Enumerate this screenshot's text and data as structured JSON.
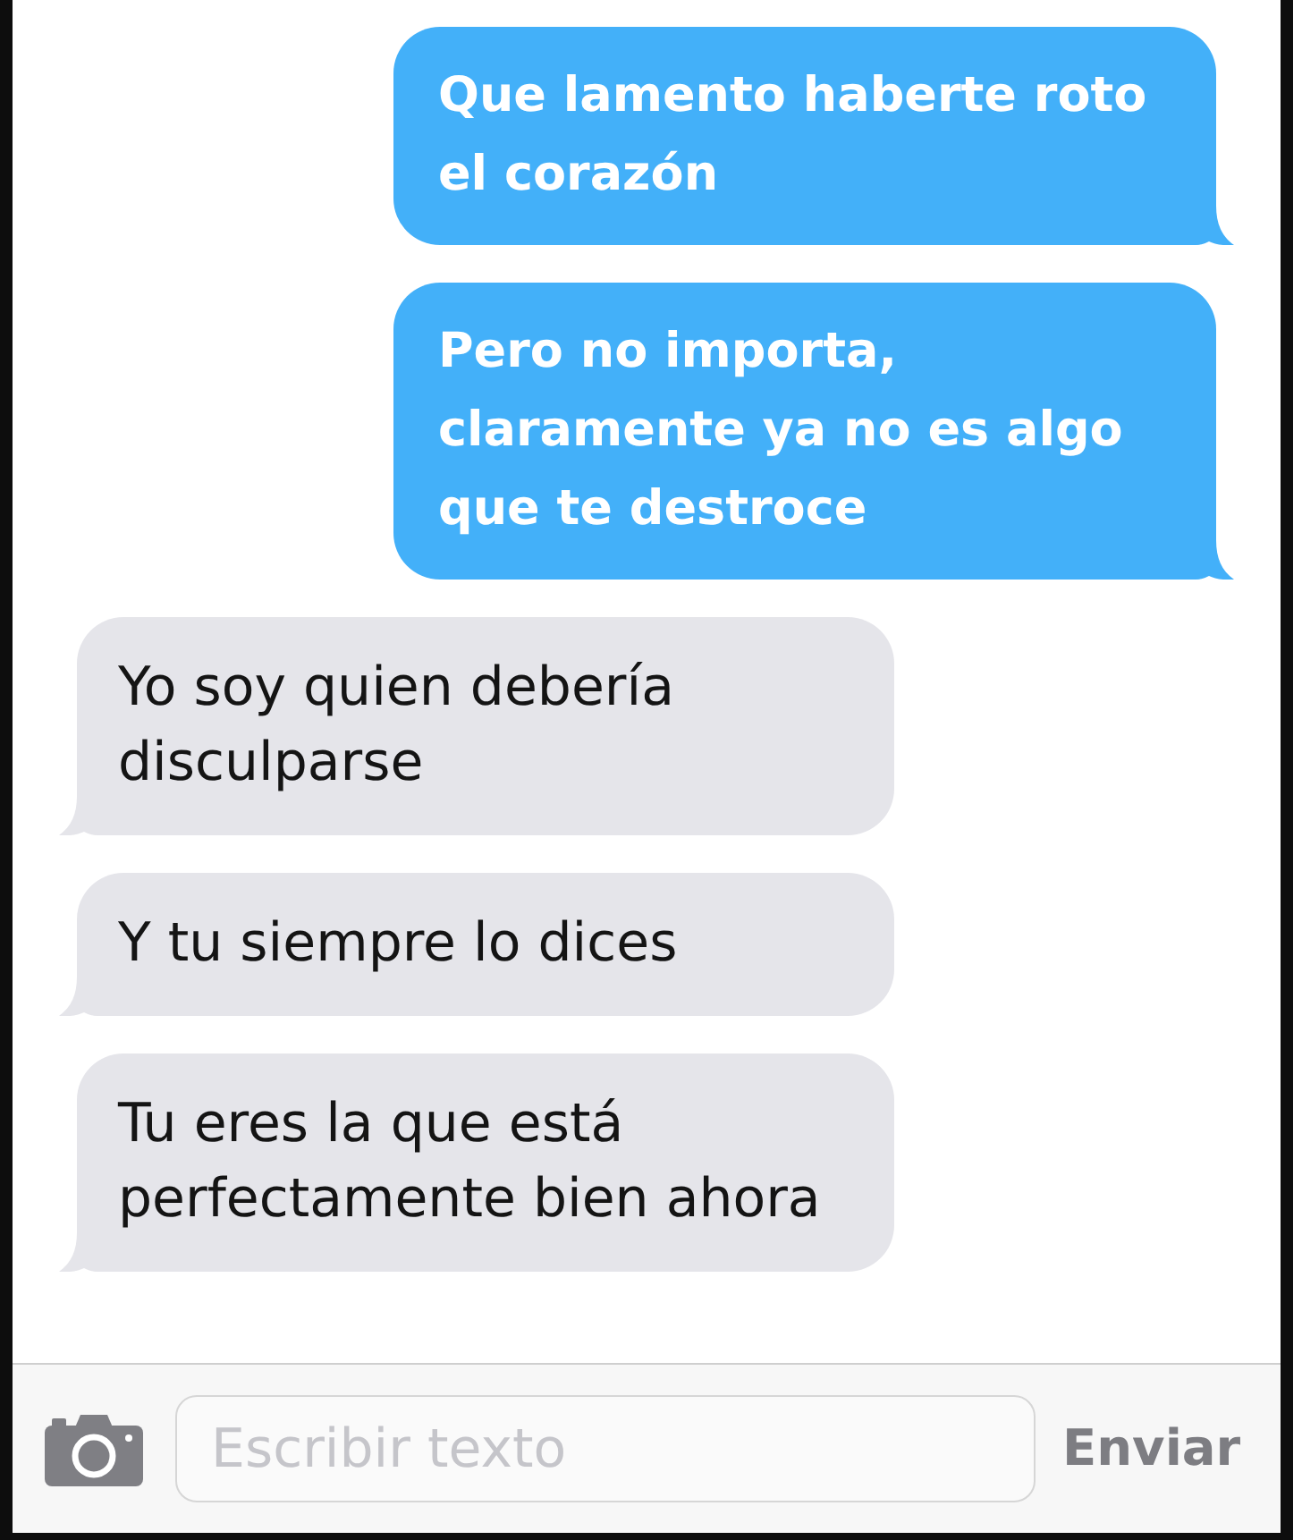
{
  "messages": [
    {
      "kind": "outgoing",
      "text": "Que lamento haberte roto el corazón"
    },
    {
      "kind": "outgoing",
      "text": "Pero no importa, claramente ya no es algo que te destroce"
    },
    {
      "kind": "incoming",
      "text": "Yo soy quien debería disculparse"
    },
    {
      "kind": "incoming",
      "text": "Y tu siempre lo dices"
    },
    {
      "kind": "incoming",
      "text": "Tu eres la que está perfectamente bien ahora"
    }
  ],
  "composer": {
    "placeholder": "Escribir texto",
    "send_label": "Enviar"
  }
}
